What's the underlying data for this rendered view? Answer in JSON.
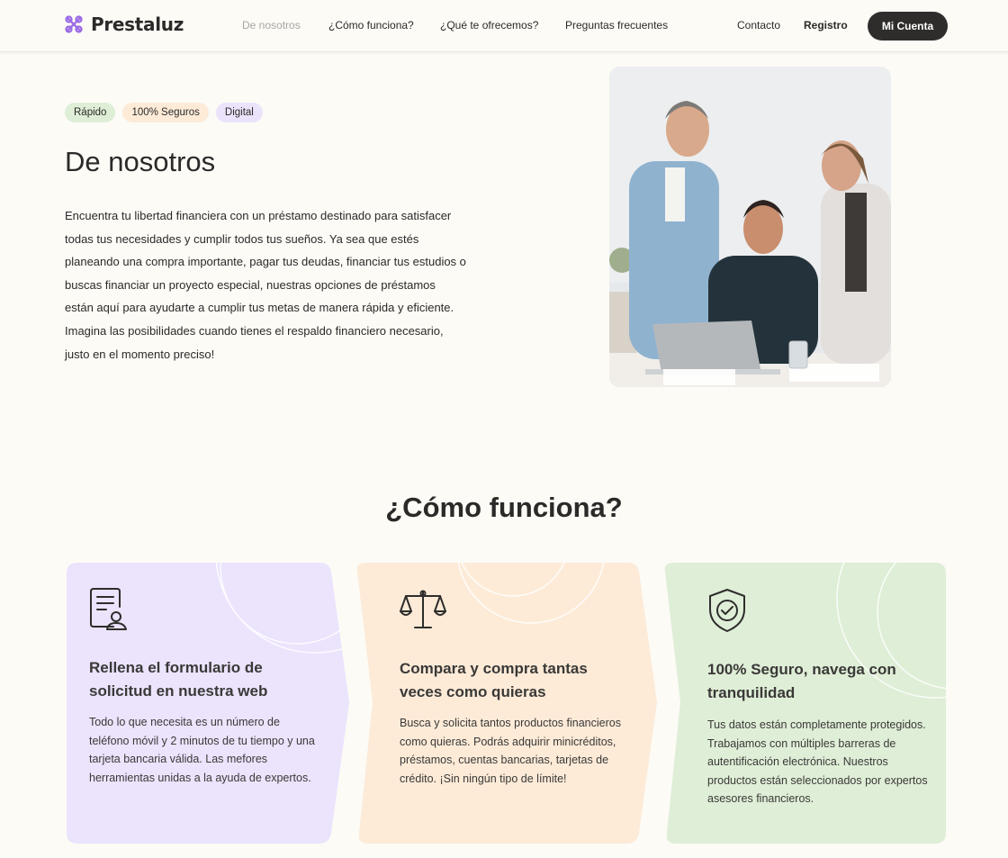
{
  "header": {
    "logo_text": "Prestaluz",
    "nav": [
      {
        "label": "De nosotros"
      },
      {
        "label": "¿Cómo funciona?"
      },
      {
        "label": "¿Qué te ofrecemos?"
      },
      {
        "label": "Preguntas frecuentes"
      }
    ],
    "contact_label": "Contacto",
    "register_label": "Registro",
    "account_label": "Mi Cuenta"
  },
  "about": {
    "tags": [
      "Rápido",
      "100% Seguros",
      "Digital"
    ],
    "title": "De nosotros",
    "text": "Encuentra tu libertad financiera con un préstamo destinado para satisfacer todas tus necesidades y cumplir todos tus sueños. Ya sea que estés planeando una compra importante, pagar tus deudas, financiar tus estudios o buscas financiar un proyecto especial, nuestras opciones de préstamos están aquí para ayudarte a cumplir tus metas de manera rápida y eficiente. Imagina las posibilidades cuando tienes el respaldo financiero necesario, justo en el momento preciso!"
  },
  "how": {
    "title": "¿Cómo funciona?",
    "steps": [
      {
        "icon": "form-user-icon",
        "title": "Rellena el formulario de solicitud en nuestra web",
        "text": "Todo lo que necesita es un número de teléfono móvil y 2 minutos de tu tiempo y una tarjeta bancaria válida. Las mefores herramientas unidas a la ayuda de expertos.",
        "color": "#ece3fd"
      },
      {
        "icon": "scales-icon",
        "title": "Compara y compra tantas veces como quieras",
        "text": "Busca y solicita tantos productos financieros como quieras. Podrás adquirir minicréditos, préstamos, cuentas bancarias, tarjetas de crédito. ¡Sin ningún tipo de límite!",
        "color": "#fdebd8"
      },
      {
        "icon": "shield-check-icon",
        "title": "100% Seguro, navega con tranquilidad",
        "text": "Tus datos están completamente protegidos. Trabajamos con múltiples barreras de autentificación electrónica. Nuestros productos están seleccionados por expertos asesores financieros.",
        "color": "#dfeed7"
      }
    ]
  },
  "colors": {
    "background": "#fcfbf6",
    "dark": "#2e2d2b",
    "purple_card": "#ece3fd",
    "orange_card": "#fdebd8",
    "green_card": "#dfeed7",
    "logo_purple": "#9b6be6"
  }
}
